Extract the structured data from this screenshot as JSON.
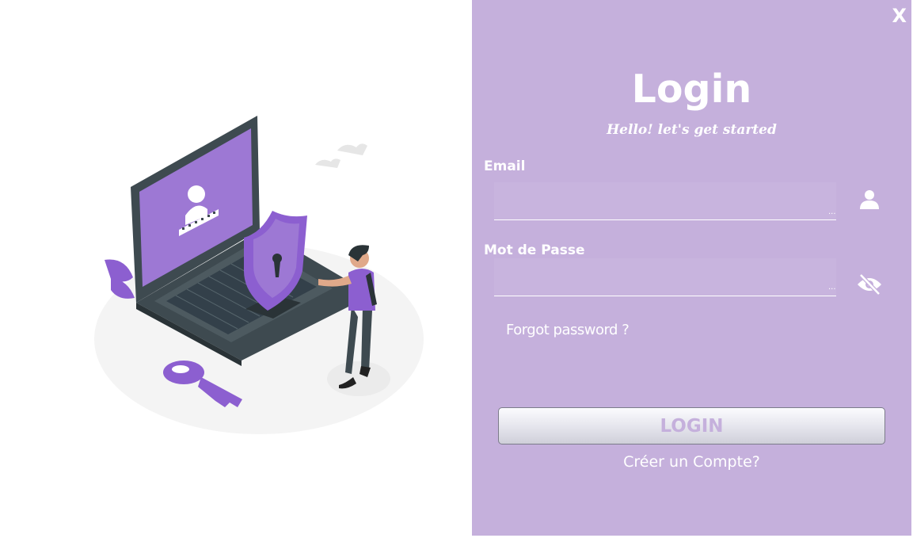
{
  "window": {
    "close_label": "X"
  },
  "login": {
    "title": "Login",
    "subtitle": "Hello!  let's get started",
    "email_label": "Email",
    "email_value": "",
    "password_label": "Mot de Passe",
    "password_value": "",
    "field_overflow": "...",
    "forgot_label": "Forgot password ?",
    "login_button": "LOGIN",
    "create_account": "Créer un Compte?"
  },
  "icons": {
    "email_field_icon": "user-icon",
    "password_field_icon": "eye-slash-icon",
    "illustration": "laptop-security-illustration"
  },
  "colors": {
    "panel_bg": "#c5b0dc",
    "accent": "#8c5fd0",
    "text": "#ffffff"
  }
}
